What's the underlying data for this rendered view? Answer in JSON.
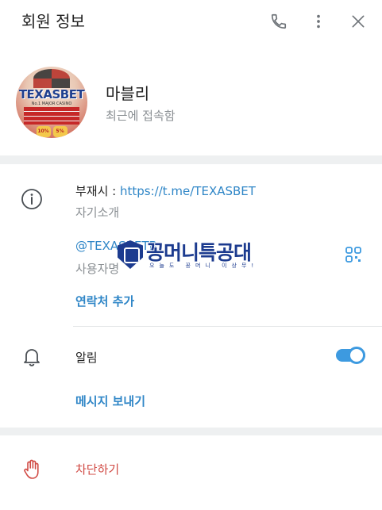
{
  "header": {
    "title": "회원 정보",
    "icons": [
      "phone-icon",
      "more-vertical-icon",
      "close-icon"
    ]
  },
  "profile": {
    "name": "마블리",
    "status": "최근에 접속함",
    "avatar_text": "TEXASBET",
    "avatar_sub": "No.1 MAJOR CASINO",
    "avatar_chips": [
      "10%",
      "5%"
    ]
  },
  "info": {
    "bio_prefix": "부재시 : ",
    "bio_link": "https://t.me/TEXASBET",
    "bio_label": "자기소개",
    "username": "@TEXASBETB",
    "username_label": "사용자명",
    "add_contact": "연락처 추가",
    "notifications_label": "알림",
    "notifications_on": true,
    "send_message": "메시지 보내기"
  },
  "block": {
    "label": "차단하기"
  },
  "watermark": {
    "title": "꽁머니특공대",
    "subtitle": "오늘도 꽁머니 이상무!"
  },
  "colors": {
    "accent": "#2f86c7",
    "danger": "#d14b45",
    "toggle": "#3d9ae0",
    "muted": "#8a8f93"
  }
}
